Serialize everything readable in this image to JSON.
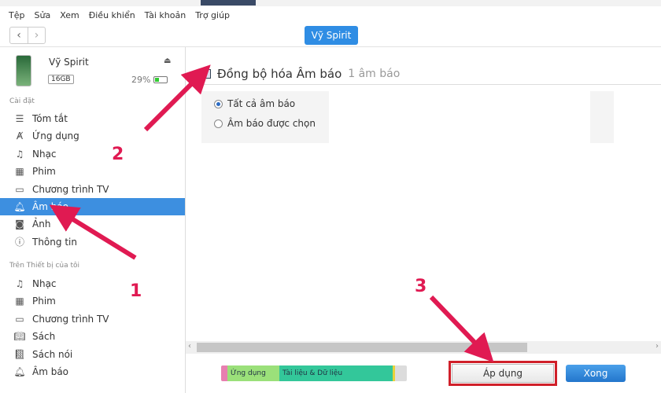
{
  "menu": [
    "Tệp",
    "Sửa",
    "Xem",
    "Điều khiển",
    "Tài khoản",
    "Trợ giúp"
  ],
  "device_button": "Vỹ Spirit",
  "device": {
    "name": "Vỹ Spirit",
    "capacity": "16GB",
    "battery": "29%",
    "battery_level": 0.29
  },
  "sidebar": {
    "section1": "Cài đặt",
    "settings": [
      {
        "label": "Tóm tắt",
        "icon": "list-icon"
      },
      {
        "label": "Ứng dụng",
        "icon": "apps-icon"
      },
      {
        "label": "Nhạc",
        "icon": "music-icon"
      },
      {
        "label": "Phim",
        "icon": "film-icon"
      },
      {
        "label": "Chương trình TV",
        "icon": "tv-icon"
      },
      {
        "label": "Âm báo",
        "icon": "bell-icon",
        "selected": true
      },
      {
        "label": "Ảnh",
        "icon": "camera-icon"
      },
      {
        "label": "Thông tin",
        "icon": "info-icon"
      }
    ],
    "section2": "Trên Thiết bị của tôi",
    "device_items": [
      {
        "label": "Nhạc",
        "icon": "music-icon"
      },
      {
        "label": "Phim",
        "icon": "film-icon"
      },
      {
        "label": "Chương trình TV",
        "icon": "tv-icon"
      },
      {
        "label": "Sách",
        "icon": "book-icon"
      },
      {
        "label": "Sách nói",
        "icon": "audiobook-icon"
      },
      {
        "label": "Âm báo",
        "icon": "bell-icon"
      }
    ]
  },
  "main": {
    "sync_label": "Đồng bộ hóa Âm báo",
    "sync_count": "1 âm báo",
    "sync_checked": true,
    "options": [
      {
        "label": "Tất cả âm báo",
        "selected": true
      },
      {
        "label": "Âm báo được chọn",
        "selected": false
      }
    ]
  },
  "capacity_bar": [
    {
      "label": "",
      "color": "#e77fb0"
    },
    {
      "label": "Ứng dụng",
      "color": "#9be07a"
    },
    {
      "label": "Tài liệu & Dữ liệu",
      "color": "#33c79a"
    },
    {
      "label": "",
      "color": "#e8d23a"
    },
    {
      "label": "",
      "color": "#dcdcdc"
    }
  ],
  "buttons": {
    "apply": "Áp dụng",
    "done": "Xong"
  },
  "annotations": [
    "1",
    "2",
    "3"
  ],
  "colors": {
    "accent": "#3d8fe0",
    "annotation": "#e01a52"
  }
}
